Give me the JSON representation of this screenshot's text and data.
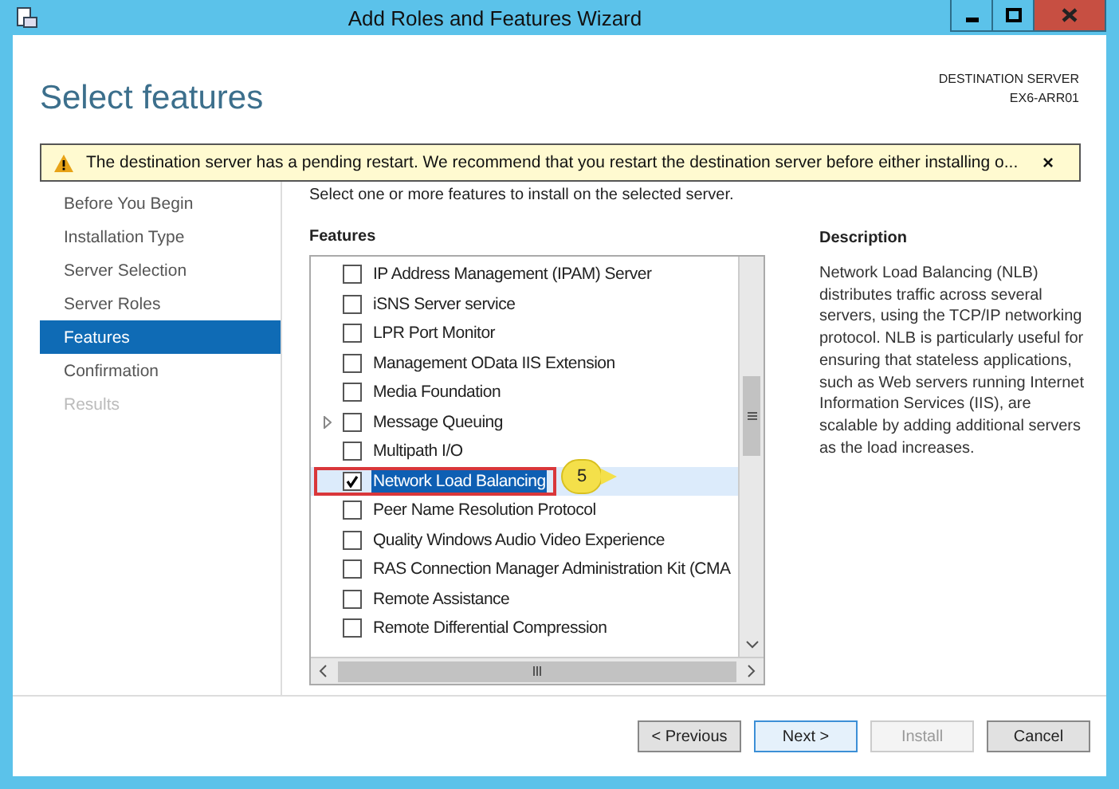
{
  "window": {
    "title": "Add Roles and Features Wizard"
  },
  "header": {
    "title": "Select features",
    "server_label": "DESTINATION SERVER",
    "server_name": "EX6-ARR01"
  },
  "warning": {
    "text": "The destination server has a pending restart. We recommend that you restart the destination server before either installing o...",
    "close": "×"
  },
  "nav": [
    {
      "label": "Before You Begin",
      "selected": false,
      "disabled": false
    },
    {
      "label": "Installation Type",
      "selected": false,
      "disabled": false
    },
    {
      "label": "Server Selection",
      "selected": false,
      "disabled": false
    },
    {
      "label": "Server Roles",
      "selected": false,
      "disabled": false
    },
    {
      "label": "Features",
      "selected": true,
      "disabled": false
    },
    {
      "label": "Confirmation",
      "selected": false,
      "disabled": false
    },
    {
      "label": "Results",
      "selected": false,
      "disabled": true
    }
  ],
  "instruction": "Select one or more features to install on the selected server.",
  "features_heading": "Features",
  "features": [
    {
      "label": "IP Address Management (IPAM) Server",
      "checked": false,
      "selected": false,
      "expandable": false,
      "outlined": false
    },
    {
      "label": "iSNS Server service",
      "checked": false,
      "selected": false,
      "expandable": false,
      "outlined": false
    },
    {
      "label": "LPR Port Monitor",
      "checked": false,
      "selected": false,
      "expandable": false,
      "outlined": false
    },
    {
      "label": "Management OData IIS Extension",
      "checked": false,
      "selected": false,
      "expandable": false,
      "outlined": false
    },
    {
      "label": "Media Foundation",
      "checked": false,
      "selected": false,
      "expandable": false,
      "outlined": false
    },
    {
      "label": "Message Queuing",
      "checked": false,
      "selected": false,
      "expandable": true,
      "outlined": false
    },
    {
      "label": "Multipath I/O",
      "checked": false,
      "selected": false,
      "expandable": false,
      "outlined": false
    },
    {
      "label": "Network Load Balancing",
      "checked": true,
      "selected": true,
      "expandable": false,
      "outlined": true,
      "callout": "5"
    },
    {
      "label": "Peer Name Resolution Protocol",
      "checked": false,
      "selected": false,
      "expandable": false,
      "outlined": false
    },
    {
      "label": "Quality Windows Audio Video Experience",
      "checked": false,
      "selected": false,
      "expandable": false,
      "outlined": false
    },
    {
      "label": "RAS Connection Manager Administration Kit (CMA",
      "checked": false,
      "selected": false,
      "expandable": false,
      "outlined": false
    },
    {
      "label": "Remote Assistance",
      "checked": false,
      "selected": false,
      "expandable": false,
      "outlined": false
    },
    {
      "label": "Remote Differential Compression",
      "checked": false,
      "selected": false,
      "expandable": false,
      "outlined": false
    }
  ],
  "description": {
    "heading": "Description",
    "text": "Network Load Balancing (NLB) distributes traffic across several servers, using the TCP/IP networking protocol. NLB is particularly useful for ensuring that stateless applications, such as Web servers running Internet Information Services (IIS), are scalable by adding additional servers as the load increases."
  },
  "buttons": [
    {
      "label": "< Previous",
      "disabled": false,
      "default": false
    },
    {
      "label": "Next >",
      "disabled": false,
      "default": true
    },
    {
      "label": "Install",
      "disabled": true,
      "default": false
    },
    {
      "label": "Cancel",
      "disabled": false,
      "default": false
    }
  ]
}
